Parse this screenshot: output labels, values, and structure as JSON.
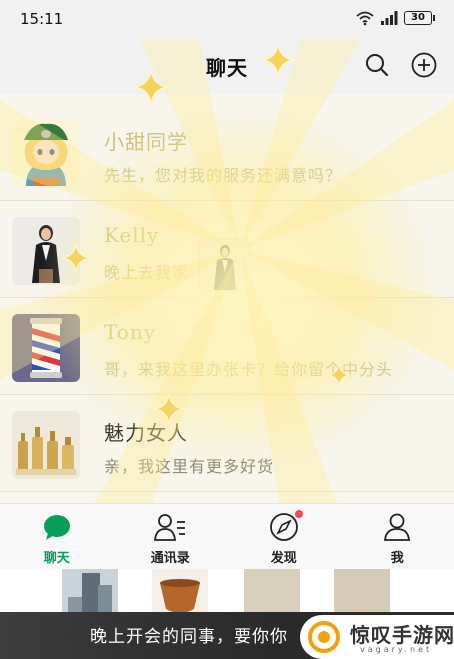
{
  "status_bar": {
    "time": "15:11",
    "battery": "30"
  },
  "header": {
    "title": "聊天"
  },
  "chats": [
    {
      "name": "小甜同学",
      "message": "先生，您对我的服务还满意吗？",
      "faded": true
    },
    {
      "name": "Kelly",
      "message": "晚上去我家",
      "faded": true
    },
    {
      "name": "Tony",
      "message": "哥，来我这里办张卡？给你留个中分头",
      "faded": true
    },
    {
      "name": "魅力女人",
      "message": "亲，我这里有更多好货",
      "faded": false
    }
  ],
  "tabs": [
    {
      "label": "聊天",
      "icon": "chat-bubble-icon",
      "active": true
    },
    {
      "label": "通讯录",
      "icon": "contacts-icon",
      "active": false
    },
    {
      "label": "发现",
      "icon": "compass-icon",
      "active": false,
      "badge": true
    },
    {
      "label": "我",
      "icon": "person-icon",
      "active": false
    }
  ],
  "subtitle": "晚上开会的同事，要你你",
  "watermark": {
    "name": "惊叹手游网",
    "url": "vagary.net"
  },
  "colors": {
    "accent_green": "#07a05a",
    "badge_red": "#f14b4b",
    "glow_yellow": "#fff2b0"
  }
}
